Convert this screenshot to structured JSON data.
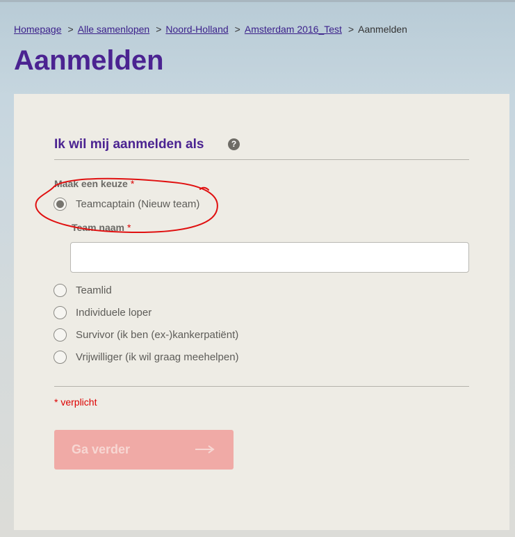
{
  "breadcrumb": {
    "items": [
      "Homepage",
      "Alle samenlopen",
      "Noord-Holland",
      "Amsterdam 2016_Test"
    ],
    "separator": ">",
    "current": "Aanmelden"
  },
  "page": {
    "title": "Aanmelden"
  },
  "form": {
    "section_title": "Ik wil mij aanmelden als",
    "help_symbol": "?",
    "choice_label": "Maak een keuze",
    "required_marker": "*",
    "options": [
      {
        "label": "Teamcaptain (Nieuw team)",
        "checked": true
      },
      {
        "label": "Teamlid",
        "checked": false
      },
      {
        "label": "Individuele loper",
        "checked": false
      },
      {
        "label": "Survivor (ik ben (ex-)kankerpatiënt)",
        "checked": false
      },
      {
        "label": "Vrijwilliger (ik wil graag meehelpen)",
        "checked": false
      }
    ],
    "team_name_label": "Team naam",
    "team_name_value": "",
    "required_note": "* verplicht",
    "next_label": "Ga verder",
    "next_icon": "arrow-right-icon"
  },
  "colors": {
    "title": "#4b2391",
    "link": "#3a1f8a",
    "required": "#dd0000",
    "button_disabled": "#f0aaa6",
    "annotation": "#e01010"
  }
}
